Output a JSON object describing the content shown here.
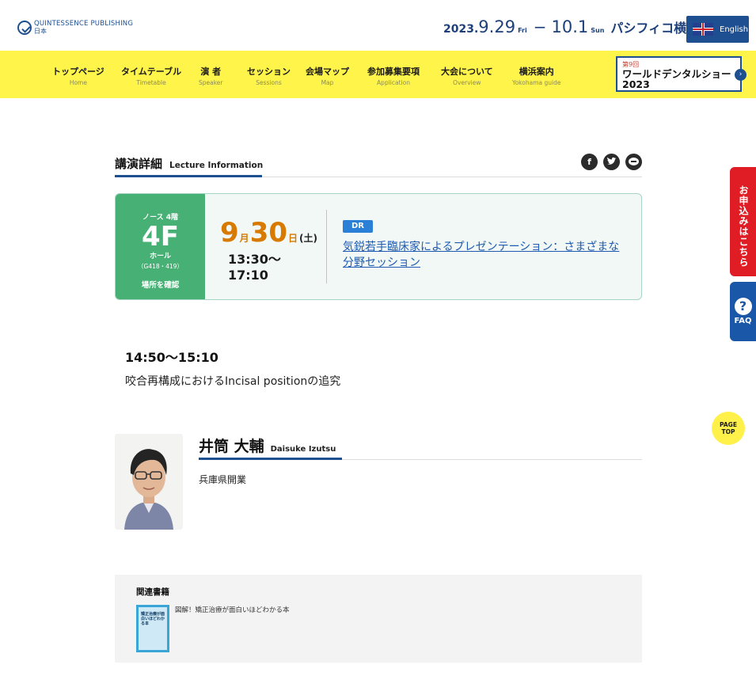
{
  "header": {
    "logo_line1": "QUINTESSENCE PUBLISHING",
    "logo_line2": "日本",
    "date_year": "2023.",
    "date_start": "9.29",
    "date_start_dow": "Fri",
    "date_dash": "−",
    "date_end": "10.1",
    "date_end_dow": "Sun",
    "venue": "パシフィコ横浜",
    "english_label": "English"
  },
  "nav": {
    "items": [
      {
        "jp": "トップページ",
        "en": "Home"
      },
      {
        "jp": "タイムテーブル",
        "en": "Timetable"
      },
      {
        "jp": "演 者",
        "en": "Speaker"
      },
      {
        "jp": "セッション",
        "en": "Sessions"
      },
      {
        "jp": "会場マップ",
        "en": "Map"
      },
      {
        "jp": "参加募集要項",
        "en": "Application"
      },
      {
        "jp": "大会について",
        "en": "Overview"
      },
      {
        "jp": "横浜案内",
        "en": "Yokohama guide"
      }
    ],
    "banner_line1": "第9回",
    "banner_line2": "ワールドデンタルショー",
    "banner_line3": "2023"
  },
  "section": {
    "title_jp": "講演詳細",
    "title_en": "Lecture Information"
  },
  "share": {
    "facebook_icon": "facebook-icon",
    "twitter_icon": "twitter-icon",
    "line_icon": "line-icon"
  },
  "lecture": {
    "area": "ノース 4階",
    "floor": "4F",
    "hall": "ホール",
    "room": "（G418・419）",
    "confirm_label": "場所を確認",
    "month": "9",
    "month_unit": "月",
    "day": "30",
    "day_unit": "日",
    "weekday": "(土)",
    "time_range": "13:30〜17:10",
    "tag": "DR",
    "session_title": "気鋭若手臨床家によるプレゼンテーション：さまざまな分野セッション"
  },
  "talk": {
    "time": "14:50〜15:10",
    "title": "咬合再構成におけるIncisal positionの追究"
  },
  "speaker": {
    "name_jp": "井筒 大輔",
    "name_en": "Daisuke Izutsu",
    "affiliation": "兵庫県開業"
  },
  "books": {
    "heading": "関連書籍",
    "items": [
      {
        "title": "図解！矯正治療が面白いほどわかる本",
        "cover_text": "矯正治療が面白いほどわかる本"
      }
    ]
  },
  "floating": {
    "apply_label": "お申込みはこちら",
    "faq_label": "FAQ",
    "faq_icon": "?",
    "pagetop_line1": "PAGE",
    "pagetop_line2": "TOP"
  },
  "colors": {
    "brand_blue": "#1d4f91",
    "nav_yellow": "#fff44a",
    "location_green": "#47b074",
    "date_orange": "#d87a00",
    "apply_red": "#e01d24",
    "faq_blue": "#1a57a8"
  }
}
